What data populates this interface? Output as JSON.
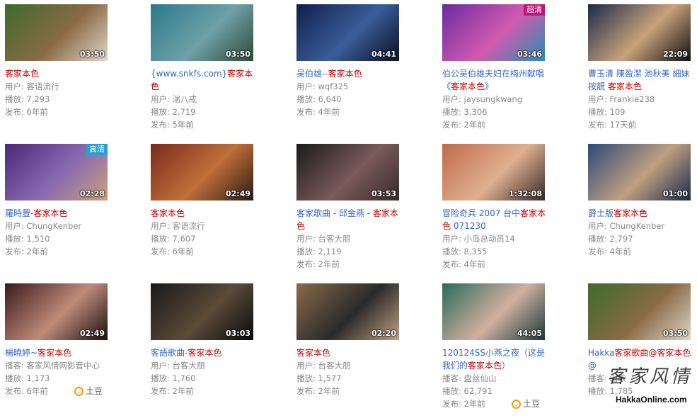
{
  "videos": [
    {
      "title_parts": [
        {
          "t": "客家本色",
          "c": "hl"
        }
      ],
      "duration": "03:50",
      "meta": [
        "用户: 客语流行",
        "播放: 7,293",
        "发布: 6年前"
      ],
      "badge": "",
      "bg": [
        "#3d6b2a",
        "#8a6a45",
        "#e0d6c8"
      ]
    },
    {
      "title_parts": [
        {
          "t": "{www.snkfs.com}",
          "c": "bl"
        },
        {
          "t": "客家本色",
          "c": "hl"
        }
      ],
      "duration": "03:50",
      "meta": [
        "用户: 湍八戒",
        "播放: 2,719",
        "发布: 5年前"
      ],
      "badge": "",
      "bg": [
        "#2a7a8a",
        "#6fa0a8",
        "#2c4b3a"
      ]
    },
    {
      "title_parts": [
        {
          "t": "吴伯雄--",
          "c": "bl"
        },
        {
          "t": "客家本色",
          "c": "hl"
        }
      ],
      "duration": "04:41",
      "meta": [
        "用户: wqf325",
        "播放: 6,640",
        "发布: 4年前"
      ],
      "badge": "",
      "bg": [
        "#0f1f4a",
        "#3b5d9a",
        "#0a0f25"
      ]
    },
    {
      "title_parts": [
        {
          "t": "伯公吴伯雄夫妇在梅州献唱《",
          "c": "bl"
        },
        {
          "t": "客家本色",
          "c": "hl"
        },
        {
          "t": "》",
          "c": "bl"
        }
      ],
      "duration": "03:46",
      "meta": [
        "用户: jaysungkwang",
        "播放: 3,306",
        "发布: 2年前"
      ],
      "badge": "超清",
      "bg": [
        "#6a2aa0",
        "#d05ab0",
        "#2a8fb0"
      ]
    },
    {
      "title_parts": [
        {
          "t": "曹玉清 陳盈潔 池秋美 細妹按靚 ",
          "c": "bl"
        },
        {
          "t": "客家本色",
          "c": "hl"
        }
      ],
      "duration": "22:09",
      "meta": [
        "用户: Frankie238",
        "播放: 109",
        "发布: 17天前"
      ],
      "badge": "",
      "bg": [
        "#1a2a4a",
        "#c9a27a",
        "#111"
      ]
    },
    {
      "title_parts": [
        {
          "t": "羅時豐-",
          "c": "bl"
        },
        {
          "t": "客家本色",
          "c": "hl"
        }
      ],
      "duration": "02:28",
      "meta": [
        "用户: ChungKenber",
        "播放: 1,510",
        "发布: 2年前"
      ],
      "badge": "高清",
      "bg": [
        "#4a2a7a",
        "#8a6ab0",
        "#c9a27a"
      ]
    },
    {
      "title_parts": [
        {
          "t": "客家本色",
          "c": "hl"
        }
      ],
      "duration": "02:49",
      "meta": [
        "用户: 客语流行",
        "播放: 7,607",
        "发布: 6年前"
      ],
      "badge": "",
      "bg": [
        "#7a2a1a",
        "#c0703a",
        "#2a1a12"
      ]
    },
    {
      "title_parts": [
        {
          "t": "客家歌曲 - 邱金燕 - ",
          "c": "bl"
        },
        {
          "t": "客家本色",
          "c": "hl"
        }
      ],
      "duration": "03:53",
      "meta": [
        "用户: 台客大朋",
        "播放: 2,119",
        "发布: 2年前"
      ],
      "badge": "",
      "bg": [
        "#1a1a1a",
        "#7a5a5a",
        "#3a2a2a"
      ]
    },
    {
      "title_parts": [
        {
          "t": "冒险奇兵 2007 台中",
          "c": "bl"
        },
        {
          "t": "客家本色",
          "c": "hl"
        },
        {
          "t": " 071230",
          "c": "bl"
        }
      ],
      "duration": "1:32:08",
      "meta": [
        "用户: 小岛总动员14",
        "播放: 8,355",
        "发布: 4年前"
      ],
      "badge": "",
      "bg": [
        "#c06a4a",
        "#e0b090",
        "#3a2a2a"
      ]
    },
    {
      "title_parts": [
        {
          "t": "爵士版",
          "c": "bl"
        },
        {
          "t": "客家本色",
          "c": "hl"
        }
      ],
      "duration": "01:00",
      "meta": [
        "用户: ChungKenber",
        "播放: 2,797",
        "发布: 4年前"
      ],
      "badge": "",
      "bg": [
        "#2a4a7a",
        "#c0a080",
        "#1a2a4a"
      ]
    },
    {
      "title_parts": [
        {
          "t": "楊曉婷~",
          "c": "bl"
        },
        {
          "t": "客家本色",
          "c": "hl"
        }
      ],
      "duration": "02:49",
      "meta": [
        "播客: 客家风情网影音中心",
        "播放: 1,173",
        "发布: 6年前"
      ],
      "badge": "",
      "bg": [
        "#3a1a1a",
        "#c08a7a",
        "#1a1010"
      ],
      "source": "土豆"
    },
    {
      "title_parts": [
        {
          "t": "客語歌曲-",
          "c": "bl"
        },
        {
          "t": "客家本色",
          "c": "hl"
        }
      ],
      "duration": "03:03",
      "meta": [
        "用户: 台客大朋",
        "播放: 1,760",
        "发布: 2年前"
      ],
      "badge": "",
      "bg": [
        "#1a1a1a",
        "#5a4a3a",
        "#0a0a0a"
      ]
    },
    {
      "title_parts": [
        {
          "t": "客家本色",
          "c": "hl"
        }
      ],
      "duration": "02:20",
      "meta": [
        "用户: 台客大朋",
        "播放: 1,577",
        "发布: 2年前"
      ],
      "badge": "",
      "bg": [
        "#8a6a4a",
        "#2a2a2a",
        "#c0a080"
      ]
    },
    {
      "title_parts": [
        {
          "t": "120124SS小燕之夜（这是我们的",
          "c": "bl"
        },
        {
          "t": "客家本色",
          "c": "hl"
        },
        {
          "t": "）",
          "c": "bl"
        }
      ],
      "duration": "44:05",
      "meta": [
        "播客: 盘丝仙山",
        "播放: 62,791",
        "发布: 2年前"
      ],
      "badge": "",
      "bg": [
        "#2a6a5a",
        "#d0b0a0",
        "#1a3a3a"
      ],
      "source": "土豆"
    },
    {
      "title_parts": [
        {
          "t": "Hakka",
          "c": "bl"
        },
        {
          "t": "客家歌曲@客家本色",
          "c": "hl"
        },
        {
          "t": "@",
          "c": "bl"
        }
      ],
      "duration": "03:50",
      "meta": [
        "播客: 山歌",
        "播放: 1,785",
        ""
      ],
      "badge": "",
      "bg": [
        "#3d6b2a",
        "#8a6a45",
        "#e0d6c8"
      ]
    }
  ],
  "colors": {
    "badge_super": "#c0147a",
    "badge_hd": "#2a9fd6"
  },
  "watermark": {
    "cn": "客家风情",
    "url": "HakkaOnline.com"
  }
}
